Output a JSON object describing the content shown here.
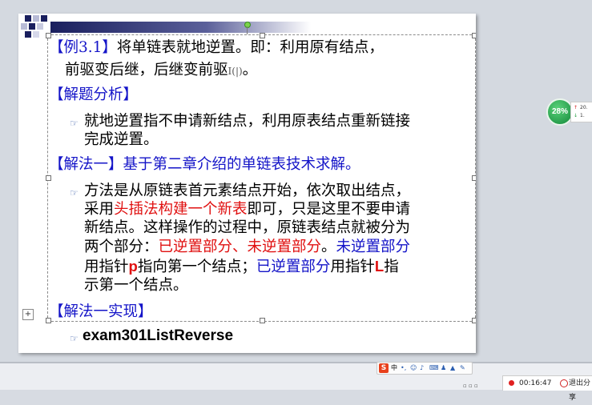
{
  "slide": {
    "example_tag": "【例3.1】",
    "line1_rest": "将单链表就地逆置。即：利用原有结点，",
    "line2": "前驱变后继，后继变前驱",
    "line2_tail": "。",
    "section1": "【解题分析】",
    "para1_line1": "就地逆置指不申请新结点，利用原表结点重新链接",
    "para1_line2": "完成逆置。",
    "section2": "【解法一】基于第二章介绍的单链表技术求解。",
    "para2_l1": "方法是从原链表首元素结点开始，依次取出结点，",
    "para2_l2_a": "采用",
    "para2_l2_b": "头插法构建一个新表",
    "para2_l2_c": "即可，只是这里不要申请",
    "para2_l3": "新结点。这样操作的过程中，原链表结点就被分为",
    "para2_l4_a": "两个部分：",
    "para2_l4_b": "已逆置部分、未逆置部分",
    "para2_l4_c": "。",
    "para2_l4_d": "未逆置部分",
    "para2_l5_a": "用指针",
    "para2_l5_b": "p",
    "para2_l5_c": "指向第一个结点；",
    "para2_l5_d": "已逆置部分",
    "para2_l5_e": "用指针",
    "para2_l5_f": "L",
    "para2_l5_g": "指",
    "para2_l6": "示第一个结点。",
    "section3": "【解法一实现】",
    "code_name": "exam301ListReverse"
  },
  "widget": {
    "percent": "28%",
    "up_value": "20.",
    "down_value": "1."
  },
  "ime": {
    "logo": "S",
    "lang": "中"
  },
  "recorder": {
    "time": "00:16:47",
    "exit_label": "退出分享"
  },
  "colors": {
    "heading_blue": "#1414c8",
    "highlight_red": "#e01010",
    "slide_bg": "#ffffff",
    "canvas_bg": "#d4d9e0"
  }
}
